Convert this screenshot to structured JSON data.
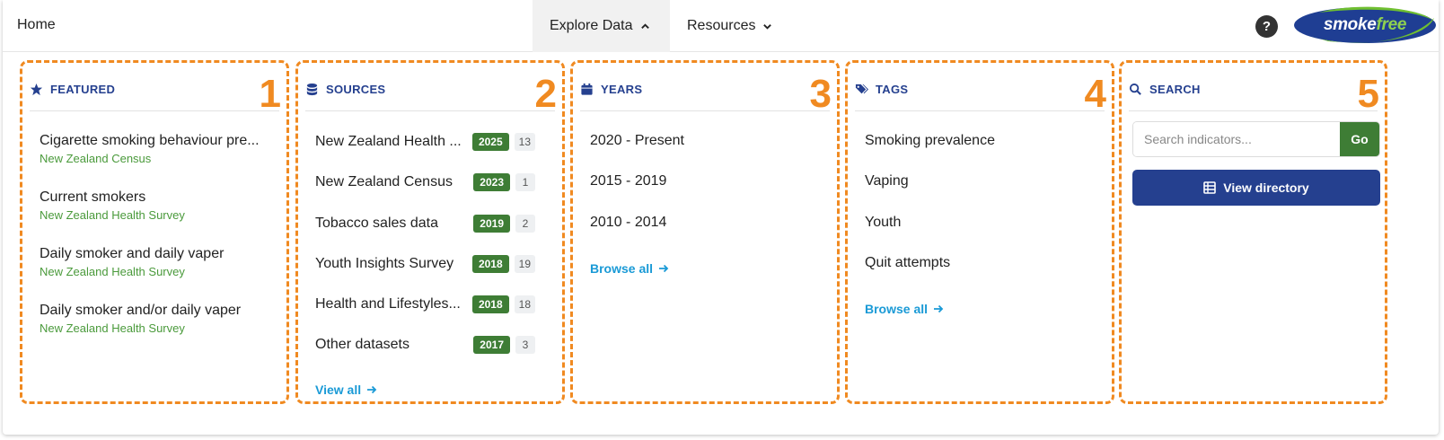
{
  "nav": {
    "home": "Home",
    "explore": "Explore Data",
    "resources": "Resources",
    "help": "?",
    "logo_part1": "smoke",
    "logo_part2": "free"
  },
  "columns": {
    "featured": {
      "number": "1",
      "title": "FEATURED",
      "items": [
        {
          "title": "Cigarette smoking behaviour pre...",
          "source": "New Zealand Census"
        },
        {
          "title": "Current smokers",
          "source": "New Zealand Health Survey"
        },
        {
          "title": "Daily smoker and daily vaper",
          "source": "New Zealand Health Survey"
        },
        {
          "title": "Daily smoker and/or daily vaper",
          "source": "New Zealand Health Survey"
        }
      ]
    },
    "sources": {
      "number": "2",
      "title": "SOURCES",
      "items": [
        {
          "name": "New Zealand Health ...",
          "year": "2025",
          "count": "13"
        },
        {
          "name": "New Zealand Census",
          "year": "2023",
          "count": "1"
        },
        {
          "name": "Tobacco sales data",
          "year": "2019",
          "count": "2"
        },
        {
          "name": "Youth Insights Survey",
          "year": "2018",
          "count": "19"
        },
        {
          "name": "Health and Lifestyles...",
          "year": "2018",
          "count": "18"
        },
        {
          "name": "Other datasets",
          "year": "2017",
          "count": "3"
        }
      ],
      "link": "View all"
    },
    "years": {
      "number": "3",
      "title": "YEARS",
      "items": [
        "2020 - Present",
        "2015 - 2019",
        "2010 - 2014"
      ],
      "link": "Browse all"
    },
    "tags": {
      "number": "4",
      "title": "TAGS",
      "items": [
        "Smoking prevalence",
        "Vaping",
        "Youth",
        "Quit attempts"
      ],
      "link": "Browse all"
    },
    "search": {
      "number": "5",
      "title": "SEARCH",
      "placeholder": "Search indicators...",
      "go": "Go",
      "directory": "View directory"
    }
  },
  "colors": {
    "accent_orange": "#f08a21",
    "brand_blue": "#25408f",
    "green": "#3e7d35",
    "link": "#1a9ad6"
  }
}
